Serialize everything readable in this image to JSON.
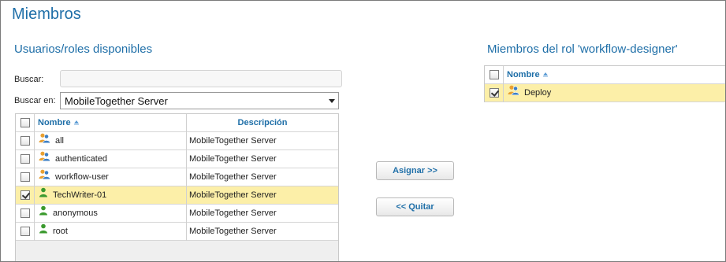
{
  "page": {
    "title": "Miembros"
  },
  "available": {
    "title": "Usuarios/roles disponibles",
    "search_label": "Buscar:",
    "search_value": "",
    "search_in_label": "Buscar en:",
    "search_in_value": "MobileTogether Server",
    "columns": {
      "name": "Nombre",
      "description": "Descripción"
    },
    "rows": [
      {
        "name": "all",
        "description": "MobileTogether Server",
        "icon": "role-icon",
        "checked": false
      },
      {
        "name": "authenticated",
        "description": "MobileTogether Server",
        "icon": "role-icon",
        "checked": false
      },
      {
        "name": "workflow-user",
        "description": "MobileTogether Server",
        "icon": "role-icon",
        "checked": false
      },
      {
        "name": "TechWriter-01",
        "description": "MobileTogether Server",
        "icon": "user-icon",
        "checked": true
      },
      {
        "name": "anonymous",
        "description": "MobileTogether Server",
        "icon": "user-icon",
        "checked": false
      },
      {
        "name": "root",
        "description": "MobileTogether Server",
        "icon": "user-icon",
        "checked": false
      }
    ]
  },
  "actions": {
    "assign": "Asignar >>",
    "remove": "<< Quitar"
  },
  "members": {
    "title": "Miembros del rol 'workflow-designer'",
    "columns": {
      "name": "Nombre"
    },
    "rows": [
      {
        "name": "Deploy",
        "icon": "role-icon",
        "checked": true
      }
    ]
  },
  "colors": {
    "accent": "#1f6fa8",
    "selected_row": "#fcefa8",
    "role_icon_blue": "#3d7fc4",
    "role_icon_orange": "#e8a032",
    "user_icon_green": "#3b9a2e"
  }
}
